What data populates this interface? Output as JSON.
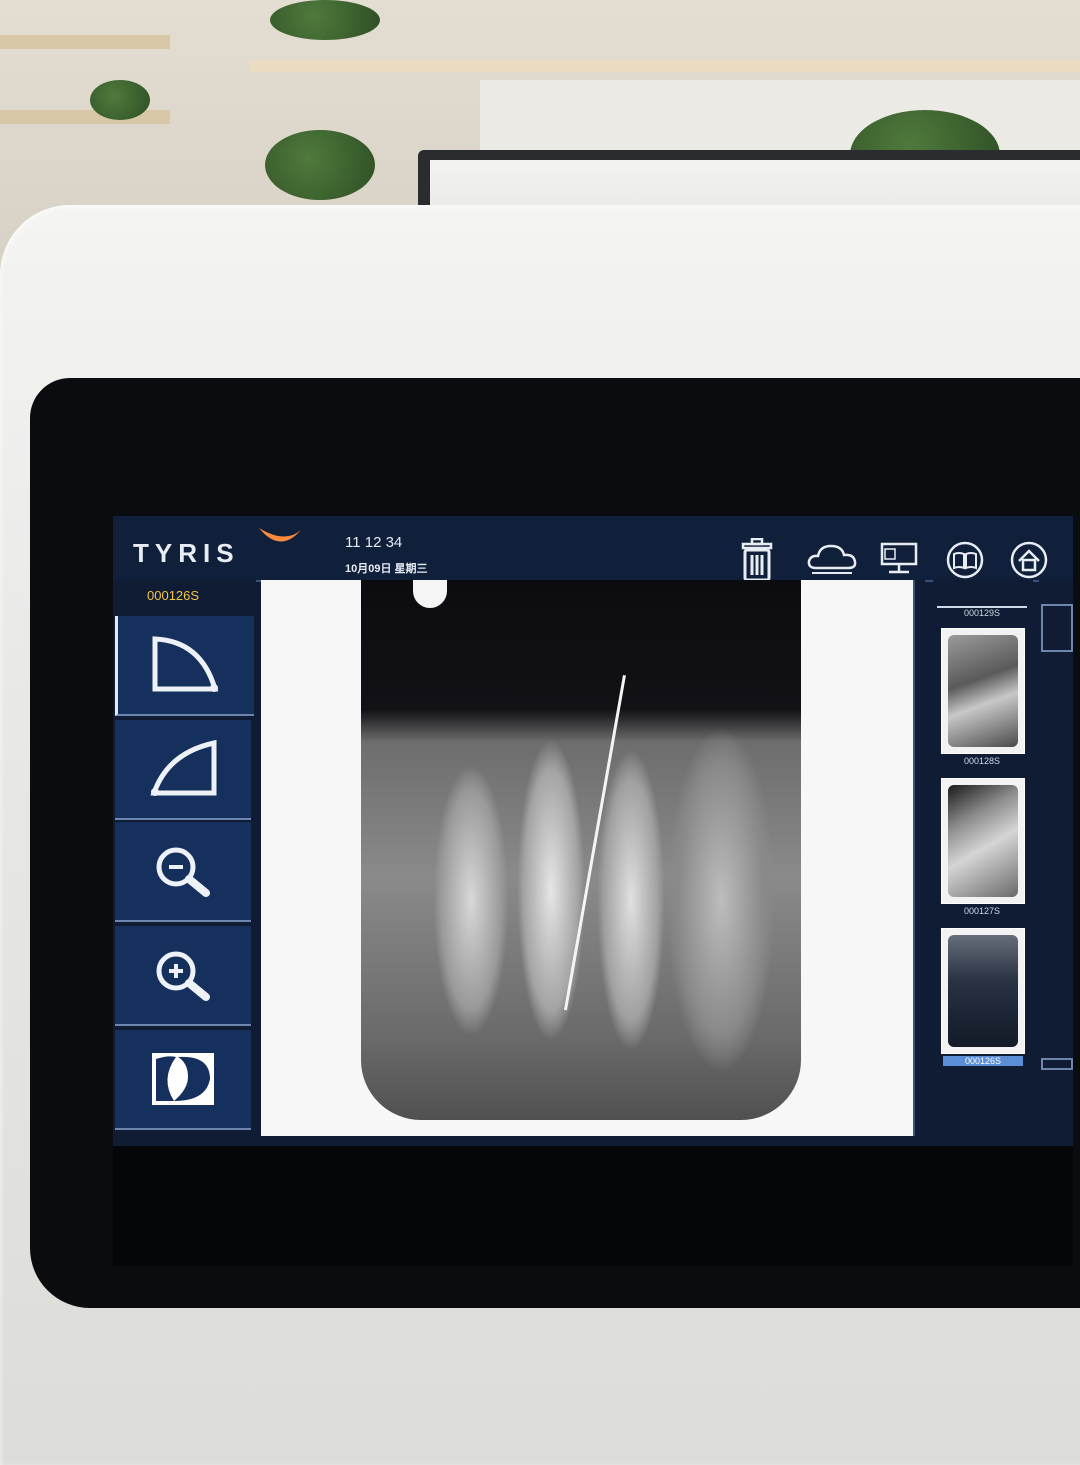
{
  "brand": {
    "name": "TYRIS",
    "accent": "#ff8a3d"
  },
  "header": {
    "time": "11 12 34",
    "date": "10月09日 星期三",
    "icons": [
      "trash-icon",
      "cloud-icon",
      "network-computer-icon",
      "book-icon",
      "home-icon"
    ]
  },
  "sidebar": {
    "patient_id": "000126S",
    "tools": [
      {
        "name": "contrast-curve-up-tool",
        "icon": "curve-up-icon",
        "active": true
      },
      {
        "name": "contrast-curve-down-tool",
        "icon": "curve-down-icon",
        "active": false
      },
      {
        "name": "zoom-out-tool",
        "icon": "zoom-out-icon",
        "active": false
      },
      {
        "name": "zoom-in-tool",
        "icon": "zoom-in-icon",
        "active": false
      },
      {
        "name": "invert-tool",
        "icon": "invert-icon",
        "active": false
      }
    ]
  },
  "thumbnails": [
    {
      "label": "000129S",
      "selected": false
    },
    {
      "label": "000128S",
      "selected": false
    },
    {
      "label": "000127S",
      "selected": false
    },
    {
      "label": "000126S",
      "selected": true
    }
  ],
  "colors": {
    "panel": "#0f1c33",
    "tool_bg": "#15305c",
    "selected": "#5b8ed6",
    "patient_id": "#f2c542"
  }
}
